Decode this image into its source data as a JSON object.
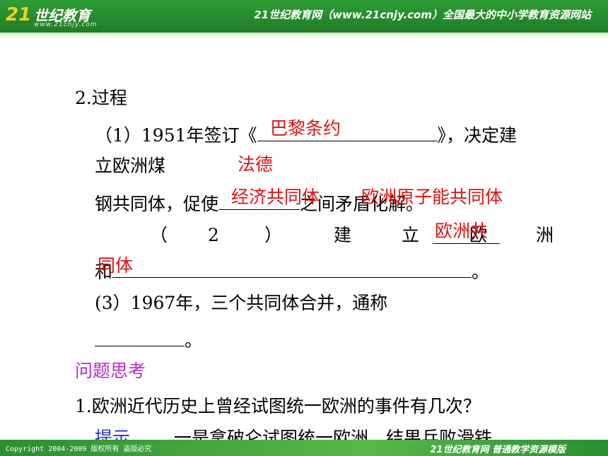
{
  "header": {
    "logo_mark": "21",
    "logo_text": "世纪教育",
    "logo_url": "www.21cnjy.com",
    "slogan": "21世纪教育网（www.21cnjy.com）全国最大的中小学教育资源网站"
  },
  "content": {
    "section_title": "2.过程",
    "item1_prefix": "（1）1951年签订《",
    "item1_suffix": "》，决定建",
    "item1_line2": "立欧洲煤",
    "item1_line3_prefix": "钢共同体，促使",
    "item1_line3_suffix": "之间矛盾化解。",
    "item2_open": "（",
    "item2_num": "2",
    "item2_close": "）",
    "item2_jian": "建",
    "item2_li": "立",
    "item2_ou": "欧",
    "item2_zhou": "洲",
    "item2_he": "和",
    "item2_end": "。",
    "item3": "(3）1967年，三个共同体合并，通称",
    "item3_end": "。"
  },
  "answers": {
    "treaty": "巴黎条约",
    "countries": "法德",
    "eec": "经济共同体",
    "euratom": "欧洲原子能共同体",
    "ec_line1": "欧洲共",
    "ec_line2": "同体"
  },
  "thinking": {
    "heading": "问题思考",
    "question": "1.欧洲近代历史上曾经试图统一欧洲的事件有几次？",
    "hint_label": "提示",
    "hint_text": "一是拿破仑试图统一欧洲，结果兵败滑铁"
  },
  "footer": {
    "copyright": "Copyright 2004-2009 版权所有 盗版必究",
    "brand": "21世纪教育网  普通教学资源模版"
  },
  "colors": {
    "header_green": "#2f9d35",
    "answer_red": "#e01212",
    "heading_purple": "#b62bc9",
    "hint_blue": "#2432d6"
  }
}
